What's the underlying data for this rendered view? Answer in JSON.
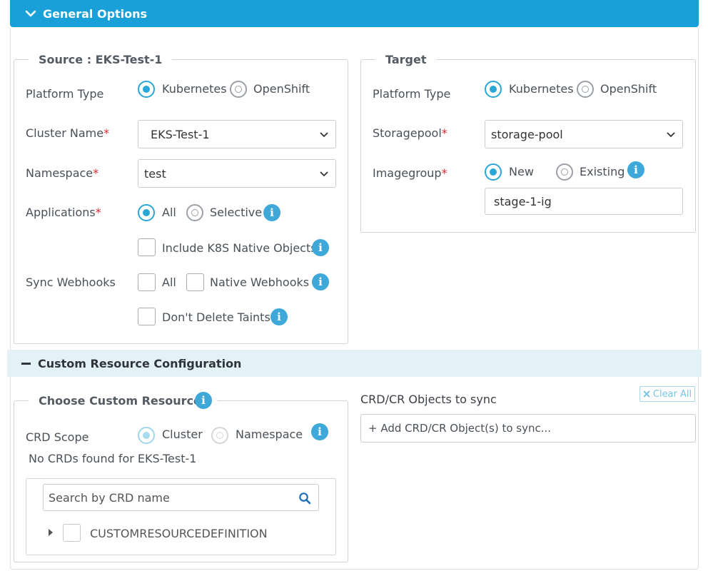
{
  "general_options": {
    "title": "General Options"
  },
  "source": {
    "legend": "Source : EKS-Test-1",
    "platform_type": {
      "label": "Platform Type",
      "options": [
        "Kubernetes",
        "OpenShift"
      ],
      "selected": "Kubernetes"
    },
    "cluster_name": {
      "label": "Cluster Name",
      "required_mark": "*",
      "value": "EKS-Test-1"
    },
    "namespace": {
      "label": "Namespace",
      "required_mark": "*",
      "value": "test"
    },
    "applications": {
      "label": "Applications",
      "required_mark": "*",
      "options": [
        "All",
        "Selective"
      ],
      "selected": "All"
    },
    "include_k8s_native": {
      "label": "Include K8S Native Objects",
      "checked": false
    },
    "sync_webhooks": {
      "label": "Sync Webhooks",
      "all_label": "All",
      "native_label": "Native Webhooks"
    },
    "dont_delete_taints": {
      "label": "Don't Delete Taints",
      "checked": false
    }
  },
  "target": {
    "legend": "Target",
    "platform_type": {
      "label": "Platform Type",
      "options": [
        "Kubernetes",
        "OpenShift"
      ],
      "selected": "Kubernetes"
    },
    "storagepool": {
      "label": "Storagepool",
      "required_mark": "*",
      "value": "storage-pool"
    },
    "imagegroup": {
      "label": "Imagegroup",
      "required_mark": "*",
      "options": [
        "New",
        "Existing"
      ],
      "selected": "New",
      "value": "stage-1-ig"
    }
  },
  "custom_resource_config": {
    "title": "Custom Resource Configuration",
    "choose_legend": "Choose Custom Resources",
    "crd_scope": {
      "label": "CRD Scope",
      "options": [
        "Cluster",
        "Namespace"
      ],
      "selected": "Cluster"
    },
    "no_crds_message": "No CRDs found for EKS-Test-1",
    "search": {
      "placeholder": "Search by CRD name"
    },
    "tree_root": "CUSTOMRESOURCEDEFINITION",
    "sync_objects": {
      "label": "CRD/CR Objects to sync",
      "add_text": "+ Add CRD/CR Object(s) to sync...",
      "clear_all": "Clear All"
    }
  },
  "colors": {
    "header": "#1aa0d8",
    "accent": "#2aa7d6",
    "required": "#e0242e",
    "section_bg": "#e4f2f8"
  }
}
